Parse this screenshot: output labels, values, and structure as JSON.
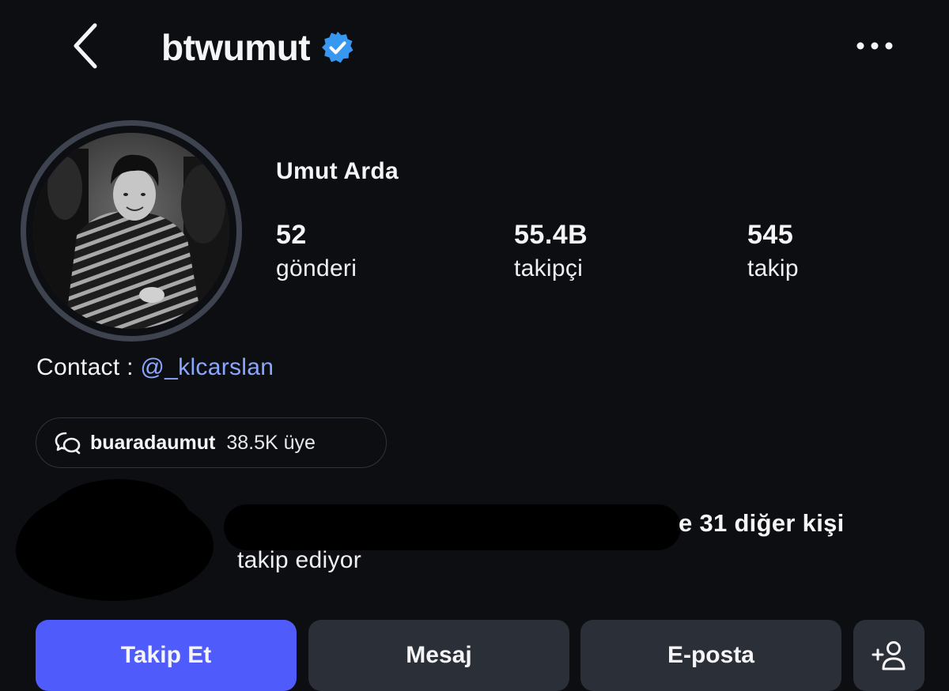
{
  "header": {
    "username": "btwumut",
    "back_icon": "chevron-left-icon",
    "verified_icon": "verified-badge-icon",
    "more_icon": "more-horizontal-icon"
  },
  "profile": {
    "display_name": "Umut Arda",
    "stats": [
      {
        "value": "52",
        "label": "gönderi"
      },
      {
        "value": "55.4B",
        "label": "takipçi"
      },
      {
        "value": "545",
        "label": "takip"
      }
    ],
    "contact_prefix": "Contact : ",
    "contact_mention": "@_klcarslan"
  },
  "channel": {
    "icon": "chat-bubbles-icon",
    "name": "buaradaumut",
    "members": "38.5K üye"
  },
  "followed_by": {
    "line1_visible": "e 31 diğer kişi",
    "line2": "takip ediyor"
  },
  "actions": {
    "follow_label": "Takip Et",
    "message_label": "Mesaj",
    "email_label": "E-posta",
    "add_user_icon": "add-person-icon"
  },
  "colors": {
    "background": "#0c0e12",
    "accent": "#4f5bfa",
    "verified": "#3897f0",
    "mention": "#8aa7ff",
    "button_secondary": "#2b2f37"
  }
}
